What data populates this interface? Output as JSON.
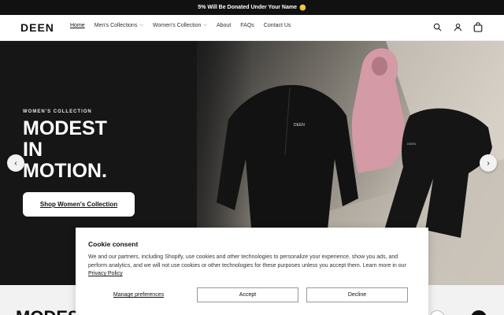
{
  "announcement": {
    "text": "5% Will Be Donated Under Your Name",
    "emoji": "🪙"
  },
  "header": {
    "logo": "DEEN",
    "nav": [
      {
        "label": "Home",
        "active": true
      },
      {
        "label": "Men's Collections",
        "has_dropdown": true
      },
      {
        "label": "Women's Collection",
        "has_dropdown": true
      },
      {
        "label": "About"
      },
      {
        "label": "FAQs"
      },
      {
        "label": "Contact Us"
      }
    ],
    "icons": [
      "search-icon",
      "account-icon",
      "cart-icon"
    ]
  },
  "hero": {
    "eyebrow": "WOMEN'S COLLECTION",
    "heading_line1": "MODEST",
    "heading_line2": "IN",
    "heading_line3": "MOTION.",
    "cta_label": "Shop Women's Collection",
    "prev_icon": "‹",
    "next_icon": "›",
    "photo_logo_1": "DEEN",
    "photo_logo_2": "DEEN"
  },
  "section_below": {
    "heading": "MODES"
  },
  "cookie": {
    "title": "Cookie consent",
    "body": "We and our partners, including Shopify, use cookies and other technologies to personalize your experience, show you ads, and perform analytics, and we will not use cookies or other technologies for these purposes unless you accept them. Learn more in our",
    "privacy_link": "Privacy Policy",
    "manage_label": "Manage preferences",
    "accept_label": "Accept",
    "decline_label": "Decline"
  },
  "colors": {
    "dark": "#111111",
    "hero_bg": "#161616",
    "top_pink": "#d49aa6"
  }
}
